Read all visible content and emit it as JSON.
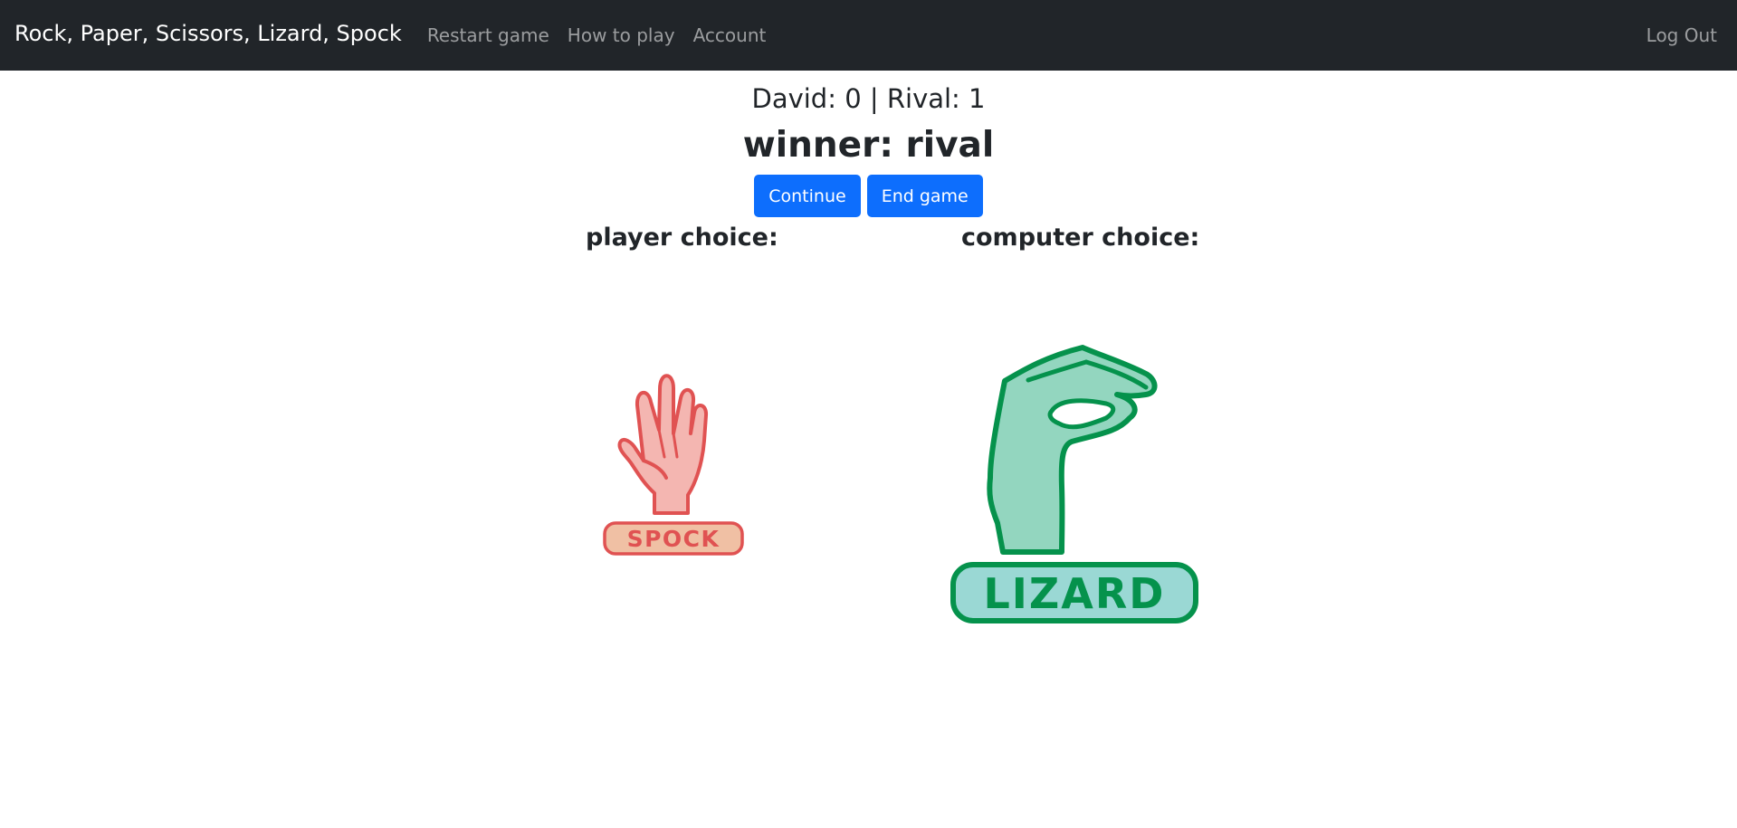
{
  "navbar": {
    "brand": "Rock, Paper, Scissors, Lizard, Spock",
    "links": [
      "Restart game",
      "How to play",
      "Account"
    ],
    "logout": "Log Out"
  },
  "game": {
    "score_text": "David: 0 | Rival: 1",
    "winner_text": "winner: rival",
    "continue_label": "Continue",
    "end_game_label": "End game",
    "player_choice_label": "player choice:",
    "computer_choice_label": "computer choice:",
    "player_choice": "SPOCK",
    "computer_choice": "LIZARD"
  },
  "colors": {
    "navbar_bg": "#212529",
    "button_bg": "#0d6efd",
    "spock_stroke": "#e05252",
    "spock_fill": "#f4b6b1",
    "spock_badge_fill": "#f0c0a4",
    "lizard_stroke": "#05924c",
    "lizard_fill": "#93d6bf",
    "lizard_badge_fill": "#9ad8d4"
  }
}
